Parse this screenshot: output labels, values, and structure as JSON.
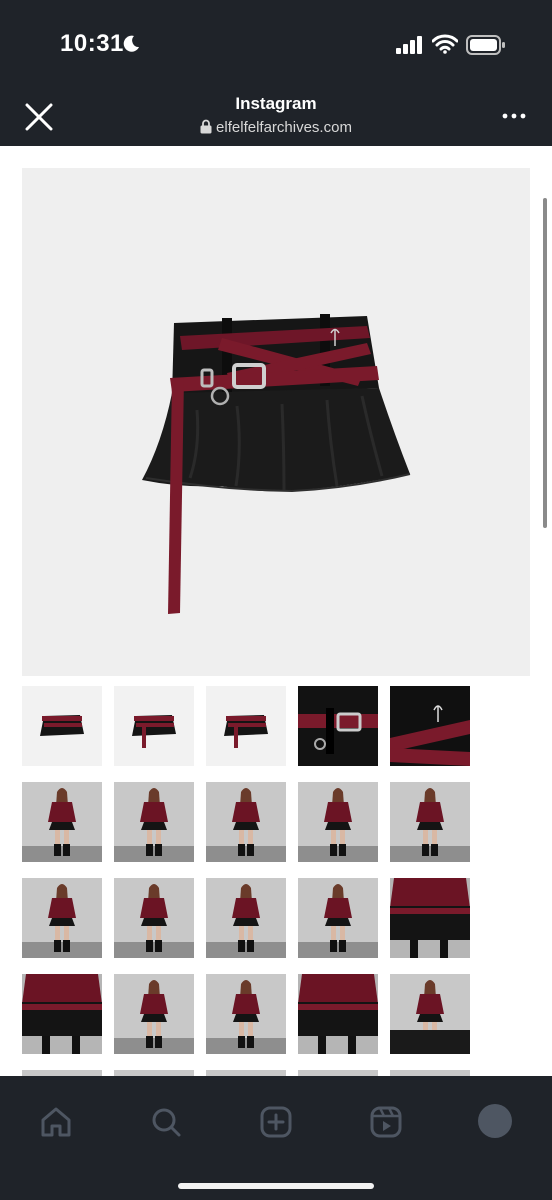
{
  "status_bar": {
    "time": "10:31",
    "icons": [
      "moon-icon",
      "cellular-signal-icon",
      "wifi-icon",
      "battery-icon"
    ]
  },
  "browser": {
    "title": "Instagram",
    "url": "elfelfelfarchives.com",
    "close_icon": "close-icon",
    "more_icon": "more-icon",
    "lock_icon": "lock-icon"
  },
  "product": {
    "main_image": "black mini skirt with crossed burgundy belts",
    "thumbnail_rows": [
      [
        "product-front",
        "product-back",
        "product-side",
        "belt-buckle-detail",
        "rose-emblem-detail"
      ],
      [
        "model-front",
        "model-front",
        "model-side",
        "model-front",
        "model-side"
      ],
      [
        "model-front",
        "model-front",
        "model-front",
        "model-side",
        "skirt-detail"
      ],
      [
        "skirt-detail",
        "model-top",
        "model-top",
        "skirt-detail",
        "model-seated"
      ]
    ]
  },
  "tab_bar": {
    "items": [
      "home-icon",
      "search-icon",
      "create-icon",
      "reels-icon",
      "profile-icon"
    ]
  },
  "colors": {
    "chrome": "#1f2329",
    "belt": "#7a1a2b",
    "skirt": "#141414",
    "top": "#6b1424"
  }
}
